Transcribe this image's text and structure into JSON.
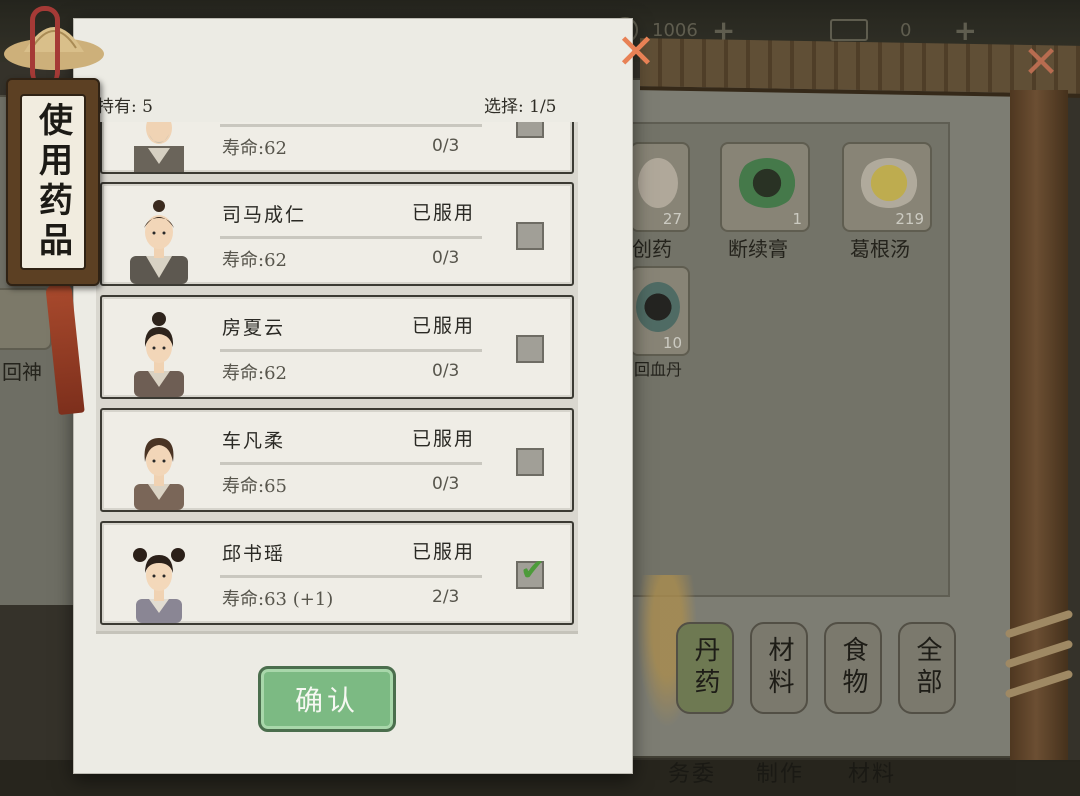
{
  "background": {
    "resources": [
      {
        "value": "1006",
        "icon": "coin-icon"
      },
      {
        "value": "0",
        "icon": "ticket-icon"
      }
    ],
    "items": [
      {
        "count": "27",
        "label": "创药"
      },
      {
        "count": "1",
        "label": "断续膏"
      },
      {
        "count": "219",
        "label": "葛根汤"
      },
      {
        "count": "10",
        "label": "回血丹"
      }
    ],
    "left_items": [
      {
        "label": "回神"
      }
    ],
    "categories": [
      {
        "label": "丹药",
        "active": true
      },
      {
        "label": "材料",
        "active": false
      },
      {
        "label": "食物",
        "active": false
      },
      {
        "label": "全部",
        "active": false
      }
    ],
    "bottom_text": [
      "务委",
      "制作",
      "材料"
    ]
  },
  "dialog": {
    "tag_title": "使用药品",
    "owned_text": "持有: 5",
    "selected_text": "选择: 1/5",
    "confirm_label": "确认",
    "characters": [
      {
        "name": "",
        "status": "",
        "lifespan": "寿命:62",
        "doses": "0/3",
        "checked": false,
        "portrait": "elder-man"
      },
      {
        "name": "司马成仁",
        "status": "已服用",
        "lifespan": "寿命:62",
        "doses": "0/3",
        "checked": false,
        "portrait": "young-man"
      },
      {
        "name": "房夏云",
        "status": "已服用",
        "lifespan": "寿命:62",
        "doses": "0/3",
        "checked": false,
        "portrait": "bun-woman"
      },
      {
        "name": "车凡柔",
        "status": "已服用",
        "lifespan": "寿命:65",
        "doses": "0/3",
        "checked": false,
        "portrait": "braid-woman"
      },
      {
        "name": "邱书瑶",
        "status": "已服用",
        "lifespan": "寿命:63 (+1)",
        "doses": "2/3",
        "checked": true,
        "portrait": "pigtail-girl"
      }
    ]
  },
  "colors": {
    "accent_close": "#e88155",
    "confirm_green": "#7cba83",
    "check_green": "#4d9b3a"
  }
}
